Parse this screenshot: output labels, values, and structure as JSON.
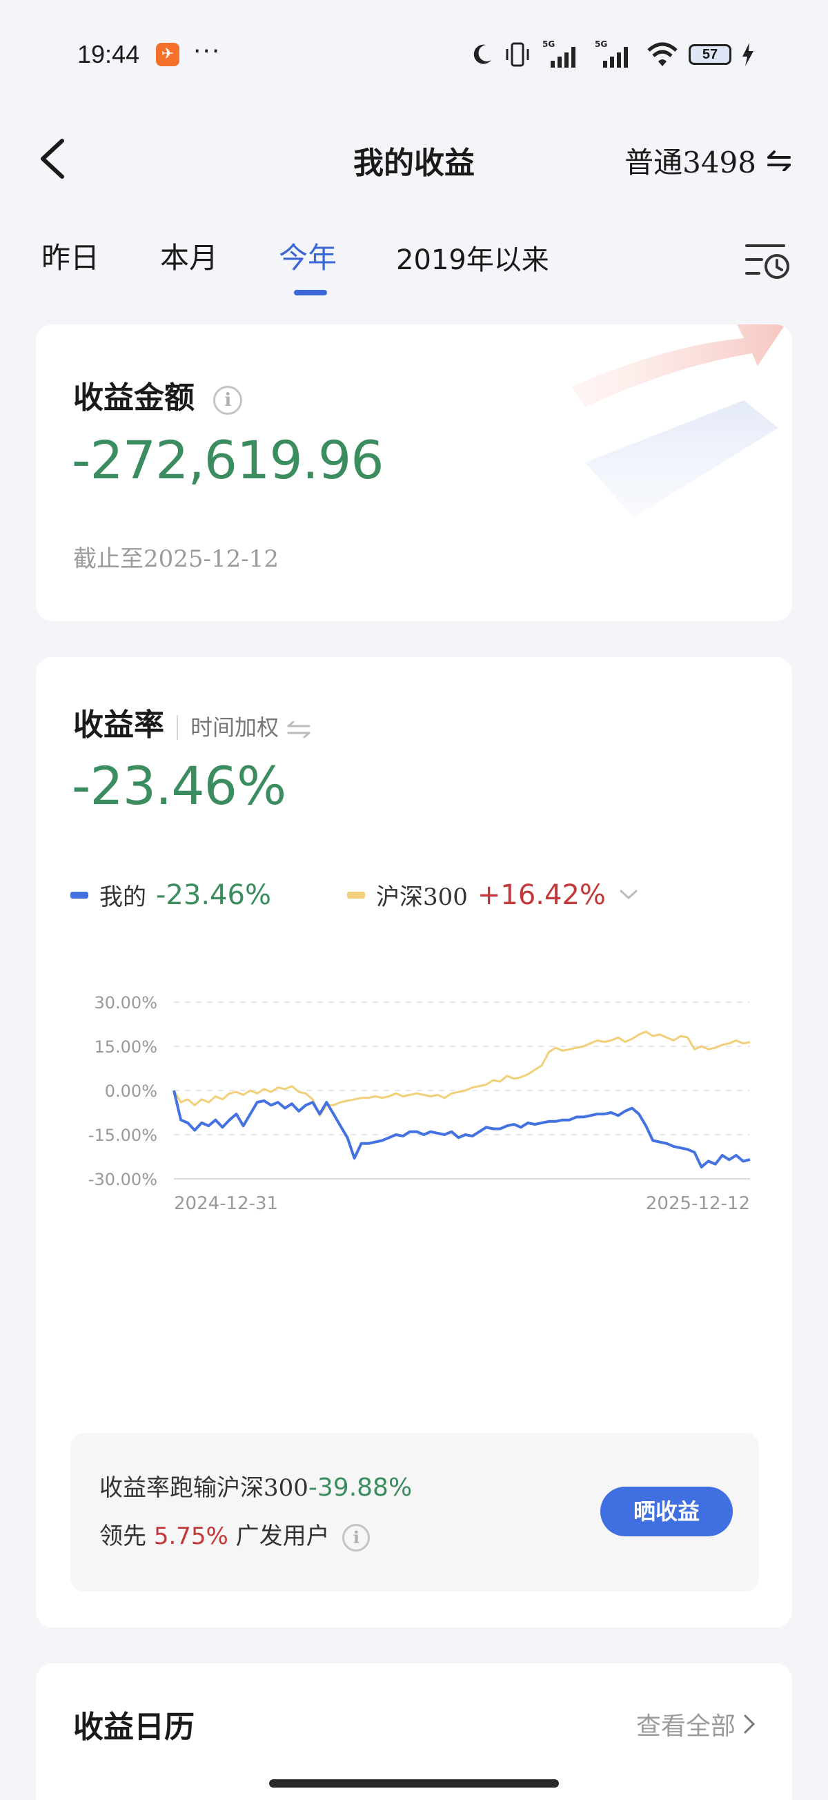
{
  "status_bar": {
    "time": "19:44",
    "dots": "···",
    "battery": "57"
  },
  "header": {
    "title": "我的收益",
    "account": "普通3498"
  },
  "tabs": [
    {
      "label": "昨日",
      "active": false
    },
    {
      "label": "本月",
      "active": false
    },
    {
      "label": "今年",
      "active": true
    },
    {
      "label": "2019年以来",
      "active": false
    }
  ],
  "earnings_card": {
    "label": "收益金额",
    "amount": "-272,619.96",
    "as_of": "截止至2025-12-12"
  },
  "rate_card": {
    "label": "收益率",
    "method": "时间加权",
    "rate": "-23.46%",
    "legend": [
      {
        "name": "我的",
        "value": "-23.46%",
        "color": "#4472e0",
        "value_color": "#3b8c5f"
      },
      {
        "name": "沪深300",
        "value": "+16.42%",
        "color": "#f2cf7a",
        "value_color": "#c2393c"
      }
    ],
    "compare": {
      "line1_prefix": "收益率跑输沪深300",
      "line1_value": "-39.88%",
      "line2_prefix": "领先",
      "line2_value": "5.75%",
      "line2_suffix": "广发用户",
      "share_button": "晒收益"
    }
  },
  "calendar_card": {
    "label": "收益日历",
    "view_all": "查看全部"
  },
  "colors": {
    "accent": "#3a66d6",
    "negative": "#3b8c5f",
    "positive": "#c2393c"
  },
  "chart_data": {
    "type": "line",
    "y_ticks": [
      "30.00%",
      "15.00%",
      "0.00%",
      "-15.00%",
      "-30.00%"
    ],
    "ylim": [
      -30,
      30
    ],
    "x_tick_labels": [
      "2024-12-31",
      "2025-12-12"
    ],
    "grid": true,
    "series": [
      {
        "name": "我的",
        "color": "#4472e0",
        "values": [
          0,
          -10,
          -11,
          -13.5,
          -11,
          -12,
          -10,
          -12.5,
          -10,
          -8,
          -12,
          -8,
          -4,
          -3.5,
          -5,
          -4,
          -6,
          -4.5,
          -7,
          -5,
          -4,
          -8,
          -4,
          -8,
          -12,
          -16,
          -23,
          -18,
          -18,
          -17.5,
          -17,
          -16,
          -15,
          -15.5,
          -14,
          -14,
          -15,
          -14,
          -14.5,
          -15,
          -14,
          -16,
          -15,
          -15.5,
          -14,
          -12.5,
          -13,
          -13,
          -12,
          -11.5,
          -12.5,
          -11,
          -11.5,
          -11,
          -10.5,
          -10.5,
          -10,
          -10,
          -9,
          -9,
          -8.5,
          -8,
          -8,
          -7.5,
          -8.5,
          -7,
          -6,
          -8,
          -12,
          -17,
          -17.5,
          -18,
          -19,
          -19.5,
          -20,
          -21,
          -26,
          -24,
          -25,
          -22,
          -23.5,
          -22,
          -24,
          -23.46
        ]
      },
      {
        "name": "沪深300",
        "color": "#f2cf7a",
        "values": [
          0,
          -4,
          -3,
          -5,
          -3,
          -4,
          -2,
          -3,
          -1,
          -0.5,
          -1.5,
          0,
          -1,
          0.5,
          -0.5,
          1,
          0.5,
          1.5,
          -0.5,
          -1,
          -3,
          -8.5,
          -5,
          -5,
          -4,
          -3.5,
          -3,
          -2.5,
          -2.5,
          -2,
          -2.5,
          -2,
          -1,
          -2,
          -1.5,
          -1,
          -1.5,
          -2,
          -1.5,
          -2.5,
          -1,
          -0.5,
          0,
          1,
          1.5,
          2,
          3.5,
          3,
          5,
          4,
          4.5,
          5.5,
          7,
          8.5,
          13,
          14.5,
          13.5,
          14,
          14.5,
          15,
          16,
          17,
          16.5,
          17,
          18,
          16.5,
          17.5,
          19,
          20,
          18.5,
          19,
          18,
          17,
          18.5,
          18,
          14,
          15,
          14,
          14.5,
          15.5,
          16,
          17,
          16,
          16.42
        ]
      }
    ]
  }
}
